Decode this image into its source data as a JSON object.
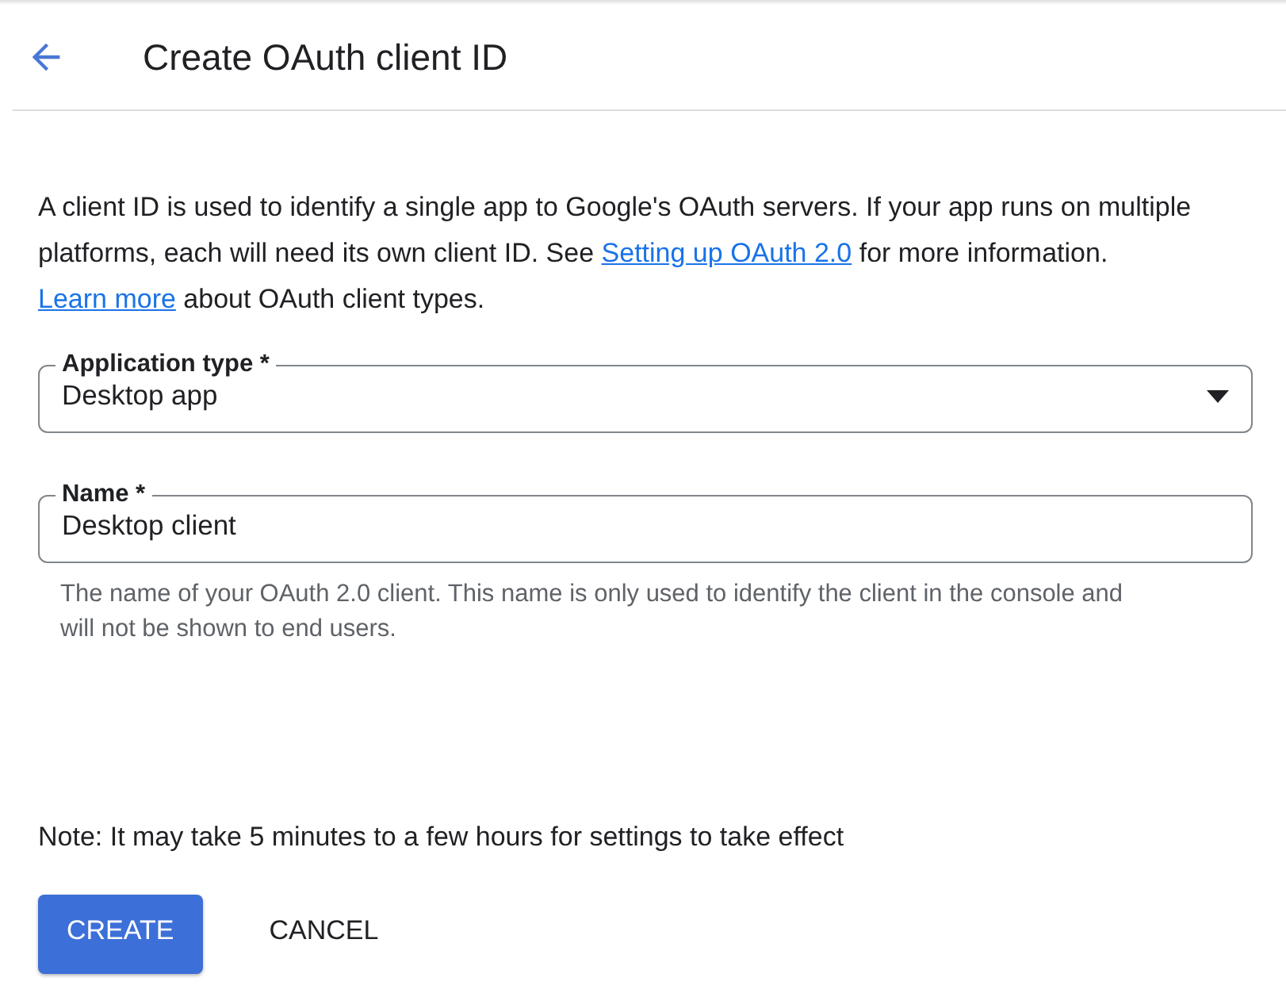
{
  "header": {
    "title": "Create OAuth client ID"
  },
  "intro": [
    {
      "kind": "text",
      "text": "A client ID is used to identify a single app to Google's OAuth servers. If your app runs on multiple platforms, each will need its own client ID. See "
    },
    {
      "kind": "link",
      "text": "Setting up OAuth 2.0"
    },
    {
      "kind": "text",
      "text": " for more information. "
    },
    {
      "kind": "link",
      "text": "Learn more"
    },
    {
      "kind": "text",
      "text": " about OAuth client types."
    }
  ],
  "fields": [
    {
      "kind": "select",
      "label": "Application type *",
      "value": "Desktop app"
    },
    {
      "kind": "text",
      "label": "Name *",
      "value": "Desktop client",
      "hint": "The name of your OAuth 2.0 client. This name is only used to identify the client in the console and will not be shown to end users."
    }
  ],
  "note": "Note: It may take 5 minutes to a few hours for settings to take effect",
  "buttons": [
    {
      "kind": "primary",
      "label": "CREATE"
    },
    {
      "kind": "text",
      "label": "CANCEL"
    }
  ]
}
